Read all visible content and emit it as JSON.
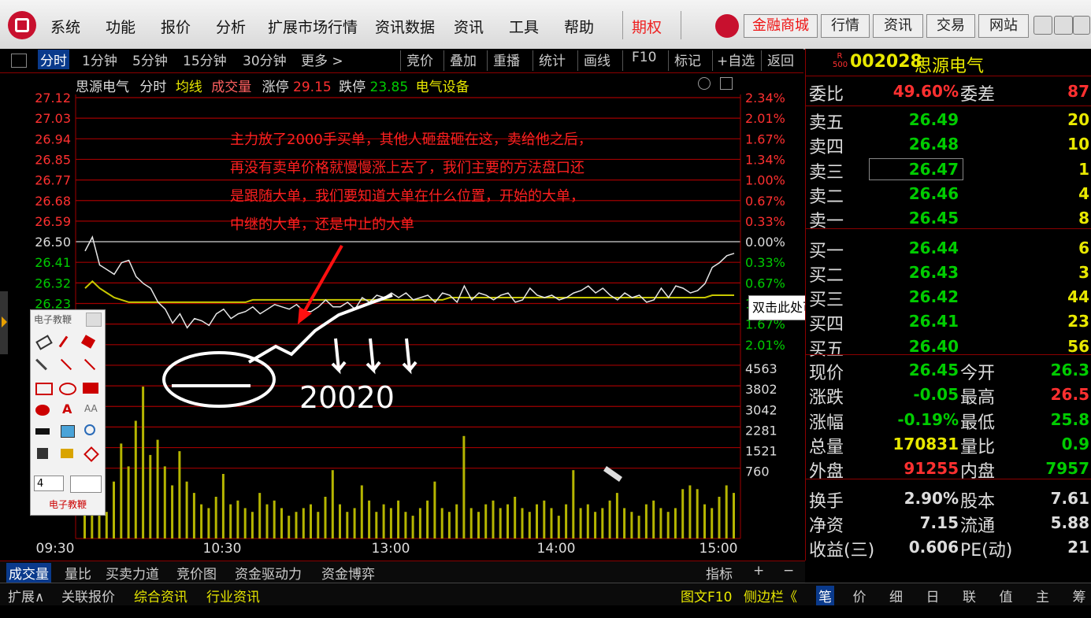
{
  "menu": {
    "items": [
      "系统",
      "功能",
      "报价",
      "分析",
      "扩展市场行情",
      "资讯数据",
      "资讯",
      "工具",
      "帮助"
    ],
    "special": "期权",
    "right_buttons": [
      "金融商城",
      "行情",
      "资讯",
      "交易",
      "网站"
    ]
  },
  "toolbar2": {
    "tabs": [
      "分时",
      "1分钟",
      "5分钟",
      "15分钟",
      "30分钟",
      "更多 >"
    ],
    "actions": [
      "竞价",
      "叠加",
      "重播",
      "统计",
      "画线",
      "F10",
      "标记",
      "+自选",
      "返回"
    ]
  },
  "chart_header": {
    "name": "思源电气",
    "mode": "分时",
    "avg": "均线",
    "vol": "成交量",
    "limit_up_label": "涨停",
    "limit_up": "29.15",
    "limit_down_label": "跌停",
    "limit_down": "23.85",
    "sector": "电气设备"
  },
  "chart_data": {
    "type": "line",
    "y_prices": [
      "27.12",
      "27.03",
      "26.94",
      "26.85",
      "26.77",
      "26.68",
      "26.59",
      "26.50",
      "26.41",
      "26.32",
      "26.23"
    ],
    "y_pcts": [
      "2.34%",
      "2.01%",
      "1.67%",
      "1.34%",
      "1.00%",
      "0.67%",
      "0.33%",
      "0.00%",
      "0.33%",
      "0.67%",
      "1.34%",
      "1.67%",
      "2.01%"
    ],
    "vol_ticks": [
      "4563",
      "3802",
      "3042",
      "2281",
      "1521",
      "760"
    ],
    "x_times": [
      "09:30",
      "10:30",
      "13:00",
      "14:00",
      "15:00"
    ],
    "series": [
      {
        "price": [
          26.46,
          26.52,
          26.4,
          26.38,
          26.36,
          26.41,
          26.42,
          26.35,
          26.32,
          26.3,
          26.24,
          26.21,
          26.15,
          26.19,
          26.13,
          26.17,
          26.16,
          26.14,
          26.19,
          26.21,
          26.17,
          26.19,
          26.2,
          26.22,
          26.19,
          26.21,
          26.23,
          26.22,
          26.21,
          26.23,
          26.2,
          26.2,
          26.22,
          26.25,
          26.22,
          26.22,
          26.24,
          26.21,
          26.26,
          26.24,
          26.27,
          26.26,
          26.28,
          26.26,
          26.28,
          26.25,
          26.26,
          26.27,
          26.24,
          26.28,
          26.27,
          26.24,
          26.31,
          26.25,
          26.28,
          26.27,
          26.25,
          26.27,
          26.28,
          26.24,
          26.25,
          26.3,
          26.27,
          26.26,
          26.27,
          26.25,
          26.26,
          26.28,
          26.29,
          26.31,
          26.28,
          26.3,
          26.27,
          26.25,
          26.28,
          26.26,
          26.27,
          26.24,
          26.25,
          26.3,
          26.26,
          26.31,
          26.3,
          26.28,
          26.29,
          26.32,
          26.39,
          26.41,
          26.44,
          26.45
        ]
      },
      {
        "avg": [
          26.3,
          26.33,
          26.3,
          26.28,
          26.26,
          26.25,
          26.24,
          26.24,
          26.24,
          26.24,
          26.24,
          26.24,
          26.24,
          26.24,
          26.24,
          26.24,
          26.24,
          26.24,
          26.24,
          26.24,
          26.24,
          26.24,
          26.24,
          26.25,
          26.25,
          26.25,
          26.25,
          26.25,
          26.25,
          26.25,
          26.25,
          26.25,
          26.25,
          26.25,
          26.25,
          26.25,
          26.25,
          26.25,
          26.25,
          26.25,
          26.25,
          26.25,
          26.25,
          26.25,
          26.25,
          26.25,
          26.25,
          26.25,
          26.25,
          26.25,
          26.26,
          26.26,
          26.26,
          26.26,
          26.26,
          26.26,
          26.26,
          26.26,
          26.26,
          26.26,
          26.26,
          26.26,
          26.26,
          26.26,
          26.26,
          26.26,
          26.26,
          26.26,
          26.26,
          26.26,
          26.26,
          26.26,
          26.26,
          26.26,
          26.26,
          26.26,
          26.26,
          26.26,
          26.26,
          26.26,
          26.26,
          26.26,
          26.26,
          26.26,
          26.26,
          26.26,
          26.27,
          26.27,
          26.27,
          26.27
        ]
      },
      {
        "volume": [
          900,
          1200,
          800,
          700,
          1500,
          2500,
          1900,
          3100,
          4000,
          2200,
          2600,
          1900,
          1400,
          2300,
          1500,
          1200,
          900,
          800,
          1100,
          1700,
          900,
          1000,
          800,
          700,
          1200,
          900,
          1000,
          800,
          600,
          700,
          800,
          900,
          700,
          1100,
          1800,
          900,
          700,
          800,
          1400,
          1000,
          700,
          900,
          800,
          1000,
          700,
          600,
          800,
          1000,
          1500,
          800,
          700,
          900,
          2700,
          800,
          700,
          900,
          1000,
          800,
          900,
          1100,
          800,
          700,
          900,
          1000,
          800,
          600,
          900,
          1800,
          800,
          900,
          700,
          800,
          1000,
          1200,
          800,
          700,
          600,
          900,
          1000,
          800,
          700,
          800,
          1300,
          1400,
          1300,
          900,
          800,
          1100,
          1400,
          1200
        ]
      }
    ]
  },
  "annotation": {
    "lines": [
      "主力放了2000手买单，其他人砸盘砸在这，卖给他之后，",
      "再没有卖单价格就慢慢涨上去了，我们主要的方法盘口还",
      "是跟随大单，我们要知道大单在什么位置，开始的大单，",
      "中继的大单，还是中止的大单"
    ],
    "handwritten": "20020"
  },
  "tooltip": "双击此处可进入分析图",
  "toolbox": {
    "title": "电子教鞭",
    "size_value": "4",
    "footer": "电子教鞭"
  },
  "stock": {
    "badge_top": "R",
    "badge_bottom": "500",
    "code": "002028",
    "name": "思源电气",
    "weibi_label": "委比",
    "weibi": "49.60%",
    "weicha_label": "委差",
    "weicha": "87",
    "sells": [
      {
        "label": "卖五",
        "price": "26.49",
        "vol": "20"
      },
      {
        "label": "卖四",
        "price": "26.48",
        "vol": "10"
      },
      {
        "label": "卖三",
        "price": "26.47",
        "vol": "1"
      },
      {
        "label": "卖二",
        "price": "26.46",
        "vol": "4"
      },
      {
        "label": "卖一",
        "price": "26.45",
        "vol": "8"
      }
    ],
    "buys": [
      {
        "label": "买一",
        "price": "26.44",
        "vol": "6"
      },
      {
        "label": "买二",
        "price": "26.43",
        "vol": "3"
      },
      {
        "label": "买三",
        "price": "26.42",
        "vol": "44"
      },
      {
        "label": "买四",
        "price": "26.41",
        "vol": "23"
      },
      {
        "label": "买五",
        "price": "26.40",
        "vol": "56"
      }
    ],
    "stats": [
      {
        "l1": "现价",
        "v1": "26.45",
        "l2": "今开",
        "v2": "26.3"
      },
      {
        "l1": "涨跌",
        "v1": "-0.05",
        "l2": "最高",
        "v2": "26.5"
      },
      {
        "l1": "涨幅",
        "v1": "-0.19%",
        "l2": "最低",
        "v2": "25.8"
      },
      {
        "l1": "总量",
        "v1": "170831",
        "l2": "量比",
        "v2": "0.9"
      },
      {
        "l1": "外盘",
        "v1": "91255",
        "l2": "内盘",
        "v2": "7957"
      }
    ],
    "stats2": [
      {
        "l1": "换手",
        "v1": "2.90%",
        "l2": "股本",
        "v2": "7.61"
      },
      {
        "l1": "净资",
        "v1": "7.15",
        "l2": "流通",
        "v2": "5.88"
      },
      {
        "l1": "收益(三)",
        "v1": "0.606",
        "l2": "PE(动)",
        "v2": "21"
      }
    ]
  },
  "bottom_tabs1": [
    "成交量",
    "量比",
    "买卖力道",
    "竞价图",
    "资金驱动力",
    "资金博弈"
  ],
  "bottom_tabs1_right": [
    "指标",
    "+",
    "−"
  ],
  "bottom_tabs2": [
    "扩展∧",
    "关联报价",
    "综合资讯",
    "行业资讯"
  ],
  "bottom_tabs2_mid": "图文F10",
  "bottom_tabs2_side": "侧边栏《",
  "right_tabs": [
    "笔",
    "价",
    "细",
    "日",
    "联",
    "值",
    "主",
    "筹"
  ],
  "colors": {
    "up": "#ff3030",
    "down": "#00cc00",
    "bg": "#000000",
    "grid": "#8b0000",
    "avg": "#c8c800",
    "price": "#e0e0e0",
    "vol": "#b5b500",
    "accent": "#0a3a8c"
  }
}
